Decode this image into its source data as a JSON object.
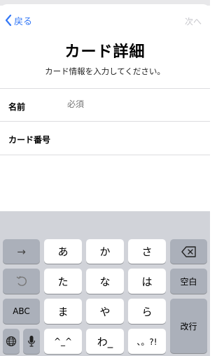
{
  "nav": {
    "back_label": "戻る",
    "next_label": "次へ"
  },
  "header": {
    "title": "カード詳細",
    "subtitle": "カード情報を入力してください。"
  },
  "form": {
    "name_label": "名前",
    "name_placeholder": "必須",
    "card_label": "カード番号"
  },
  "keyboard": {
    "row1": [
      "→",
      "あ",
      "か",
      "さ"
    ],
    "row2": [
      "た",
      "な",
      "は"
    ],
    "row3": [
      "ABC",
      "ま",
      "や",
      "ら"
    ],
    "row4": [
      "^_^",
      "わ_",
      "、。?!"
    ],
    "space_label": "空白",
    "enter_label": "改行"
  },
  "colors": {
    "accent": "#3478f6",
    "disabled": "#c7c7cc",
    "keyboard_bg": "#d1d3d9",
    "key_light": "#ffffff",
    "key_dark": "#abb0ba"
  }
}
